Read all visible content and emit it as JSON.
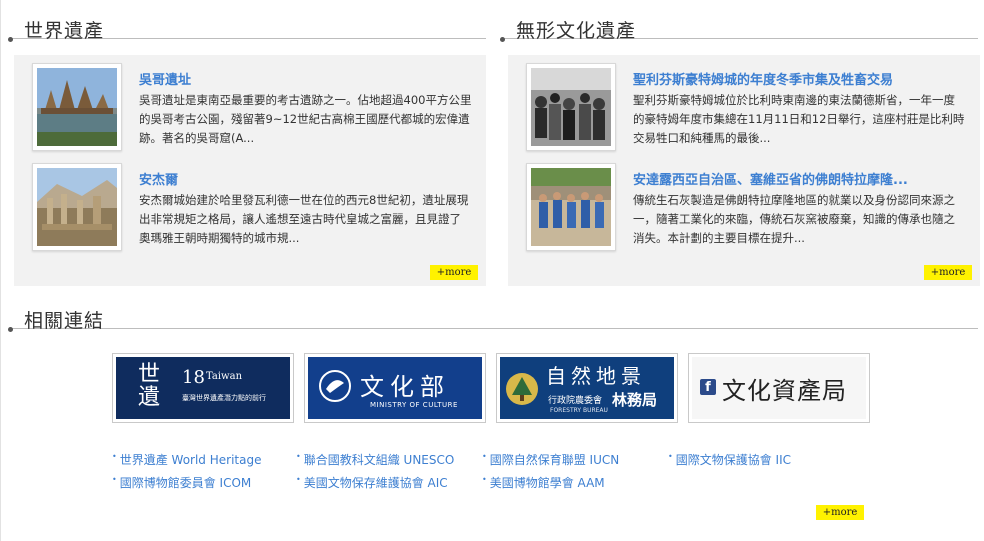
{
  "heritage": {
    "title": "世界遺產",
    "items": [
      {
        "title": "吳哥遺址",
        "desc": "吳哥遺址是東南亞最重要的考古遺跡之一。佔地超過400平方公里的吳哥考古公園，殘留著9~12世紀古高棉王國歷代都城的宏偉遺跡。著名的吳哥窟(A..."
      },
      {
        "title": "安杰爾",
        "desc": "安杰爾城始建於哈里發瓦利德一世在位的西元8世紀初，遺址展現出非常規矩之格局，讓人遙想至遠古時代皇城之富麗，且見證了奧瑪雅王朝時期獨特的城市規..."
      }
    ],
    "more": "+more"
  },
  "intangible": {
    "title": "無形文化遺產",
    "items": [
      {
        "title": "聖利芬斯豪特姆城的年度冬季市集及牲畜交易",
        "desc": "聖利芬斯豪特姆城位於比利時東南邊的東法蘭德斯省，一年一度的豪特姆年度市集總在11月11日和12日舉行，這座村莊是比利時交易牲口和純種馬的最後..."
      },
      {
        "title": "安達露西亞自治區、塞維亞省的佛朗特拉摩隆...",
        "desc": "傳統生石灰製造是佛朗特拉摩隆地區的就業以及身份認同來源之一，隨著工業化的來臨，傳統石灰窯被廢棄，知識的傳承也隨之消失。本計劃的主要目標在提升..."
      }
    ],
    "more": "+more"
  },
  "links": {
    "title": "相關連結",
    "banners": {
      "heritage18": {
        "big": "世遺",
        "num": "18",
        "en": "Taiwan",
        "sub": "臺灣世界遺產潛力點的前行"
      },
      "moc": {
        "name": "文化部",
        "en": "MINISTRY OF CULTURE"
      },
      "forestry": {
        "name": "自然地景",
        "sub": "行政院農委會",
        "name2": "林務局",
        "en": "FORESTRY BUREAU"
      },
      "boch": {
        "name": "文化資產局"
      }
    },
    "items": [
      "世界遺產 World Heritage",
      "聯合國教科文組織 UNESCO",
      "國際自然保育聯盟 IUCN",
      "國際文物保護協會 IIC",
      "國際博物館委員會 ICOM",
      "美國文物保存維護協會 AIC",
      "美國博物館學會 AAM"
    ],
    "bullet": "•",
    "more": "+more"
  }
}
